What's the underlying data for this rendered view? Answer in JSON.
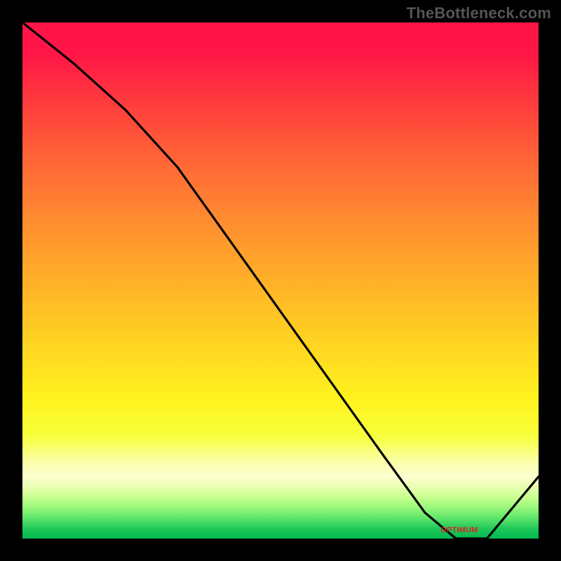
{
  "attribution": "TheBottleneck.com",
  "axes": {
    "x_label": "",
    "y_label": ""
  },
  "optimum_marker": {
    "text": "OPTIMUM",
    "x_frac": 0.81
  },
  "chart_data": {
    "type": "line",
    "title": "",
    "xlabel": "",
    "ylabel": "",
    "xlim": [
      0,
      1
    ],
    "ylim": [
      0,
      100
    ],
    "x": [
      0.0,
      0.1,
      0.2,
      0.3,
      0.4,
      0.5,
      0.6,
      0.7,
      0.78,
      0.84,
      0.9,
      1.0
    ],
    "values": [
      100,
      92,
      83,
      72,
      58,
      44,
      30,
      16,
      5,
      0,
      0,
      12
    ],
    "annotations": [
      {
        "text": "OPTIMUM",
        "x": 0.87,
        "y": 0
      }
    ]
  },
  "colors": {
    "curve": "#000000",
    "optimum_text": "#D22222",
    "background": "#000000"
  }
}
